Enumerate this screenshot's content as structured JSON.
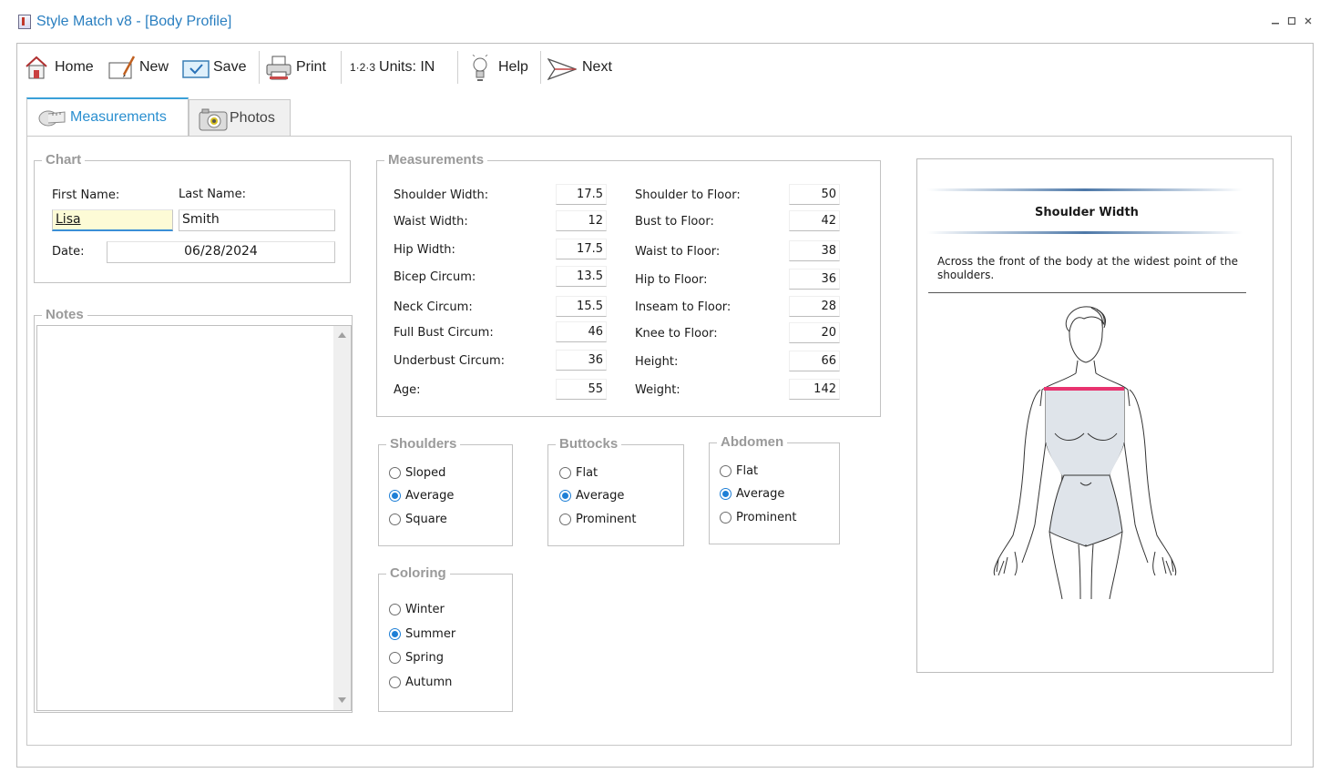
{
  "window": {
    "title": "Style Match v8 - [Body Profile]",
    "min": "‗",
    "max": "□",
    "close": "×"
  },
  "toolbar": {
    "home": "Home",
    "new": "New",
    "save": "Save",
    "print": "Print",
    "units_prefix": "1·2·3",
    "units": "Units: IN",
    "help": "Help",
    "next": "Next",
    "icons": [
      "home-icon",
      "new-icon",
      "save-icon",
      "print-icon",
      "units-icon",
      "help-bulb-icon",
      "next-arrow-icon"
    ]
  },
  "tabs": [
    {
      "label": "Measurements",
      "active": true,
      "icon": "tape-measure-icon"
    },
    {
      "label": "Photos",
      "active": false,
      "icon": "camera-icon"
    }
  ],
  "chart": {
    "legend": "Chart",
    "first_name_label": "First Name:",
    "last_name_label": "Last Name:",
    "first_name": "Lisa",
    "last_name": "Smith",
    "date_label": "Date:",
    "date": "06/28/2024"
  },
  "notes": {
    "legend": "Notes",
    "text": ""
  },
  "measurements": {
    "legend": "Measurements",
    "left": [
      {
        "label": "Shoulder Width:",
        "value": "17.5"
      },
      {
        "label": "Waist Width:",
        "value": "12"
      },
      {
        "label": "Hip Width:",
        "value": "17.5"
      },
      {
        "label": "Bicep Circum:",
        "value": "13.5"
      },
      {
        "label": "Neck Circum:",
        "value": "15.5"
      },
      {
        "label": "Full Bust Circum:",
        "value": "46"
      },
      {
        "label": "Underbust Circum:",
        "value": "36"
      },
      {
        "label": "Age:",
        "value": "55"
      }
    ],
    "right": [
      {
        "label": "Shoulder to Floor:",
        "value": "50"
      },
      {
        "label": "Bust to Floor:",
        "value": "42"
      },
      {
        "label": "Waist to Floor:",
        "value": "38"
      },
      {
        "label": "Hip to Floor:",
        "value": "36"
      },
      {
        "label": "Inseam to Floor:",
        "value": "28"
      },
      {
        "label": "Knee to Floor:",
        "value": "20"
      },
      {
        "label": "Height:",
        "value": "66"
      },
      {
        "label": "Weight:",
        "value": "142"
      }
    ]
  },
  "shoulders": {
    "legend": "Shoulders",
    "options": [
      "Sloped",
      "Average",
      "Square"
    ],
    "selected": "Average"
  },
  "buttocks": {
    "legend": "Buttocks",
    "options": [
      "Flat",
      "Average",
      "Prominent"
    ],
    "selected": "Average"
  },
  "abdomen": {
    "legend": "Abdomen",
    "options": [
      "Flat",
      "Average",
      "Prominent"
    ],
    "selected": "Average"
  },
  "coloring": {
    "legend": "Coloring",
    "options": [
      "Winter",
      "Summer",
      "Spring",
      "Autumn"
    ],
    "selected": "Summer"
  },
  "info": {
    "heading": "Shoulder Width",
    "description": "Across the front of the body at the widest point of the shoulders.",
    "highlight_color": "#e8336f"
  },
  "colors": {
    "accent": "#2a7fc0",
    "tab_active": "#3aa0d8",
    "radio": "#1e7fd6",
    "legend": "#9a9a9a"
  }
}
